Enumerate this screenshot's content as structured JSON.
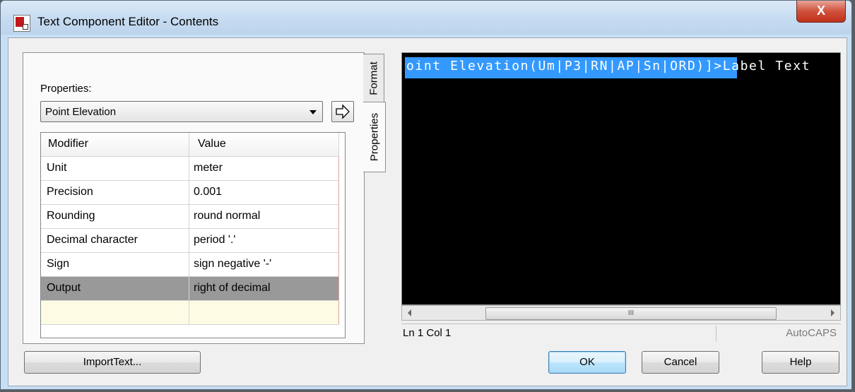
{
  "window": {
    "title": "Text Component Editor - Contents",
    "close_glyph": "X"
  },
  "properties": {
    "label": "Properties:",
    "selected": "Point Elevation",
    "grid": {
      "headers": [
        "Modifier",
        "Value"
      ],
      "rows": [
        {
          "modifier": "Unit",
          "value": "meter"
        },
        {
          "modifier": "Precision",
          "value": "0.001"
        },
        {
          "modifier": "Rounding",
          "value": "round normal"
        },
        {
          "modifier": "Decimal character",
          "value": "period '.'"
        },
        {
          "modifier": "Sign",
          "value": "sign negative '-'"
        },
        {
          "modifier": "Output",
          "value": "right of decimal"
        }
      ],
      "selected_row": "Output"
    }
  },
  "tabs": {
    "format": "Format",
    "properties": "Properties"
  },
  "editor": {
    "selected_text": "oint Elevation(Um|P3|RN|AP|Sn|ORD)]>",
    "rest_text": "Label Text",
    "background": "#000000",
    "selection_color": "#3399ff",
    "scroll_grip": "III"
  },
  "status": {
    "position": "Ln 1 Col 1",
    "caps": "AutoCAPS"
  },
  "buttons": {
    "import_text": "ImportText...",
    "ok": "OK",
    "cancel": "Cancel",
    "help": "Help"
  }
}
